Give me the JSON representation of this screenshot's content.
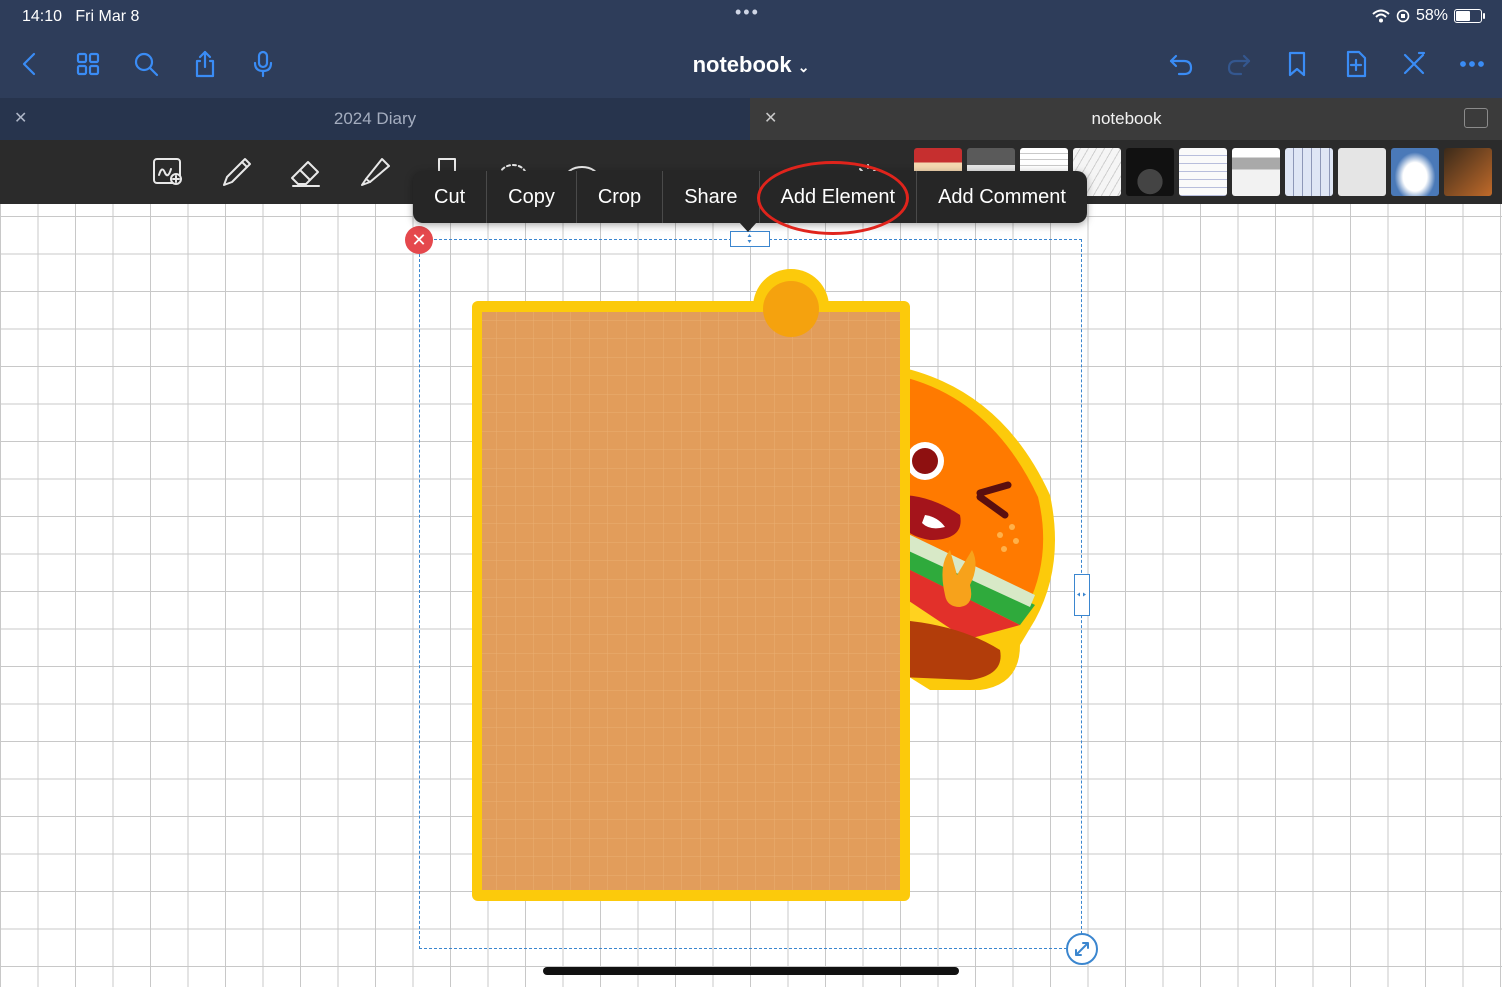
{
  "status": {
    "time": "14:10",
    "date": "Fri Mar 8",
    "battery": "58%",
    "battery_level": 0.58
  },
  "header": {
    "title": "notebook",
    "left_icons": [
      "back-icon",
      "grid-icon",
      "search-icon",
      "share-icon",
      "microphone-icon"
    ],
    "right_icons": [
      "undo-icon",
      "redo-icon",
      "bookmark-icon",
      "add-page-icon",
      "close-toolbar-icon",
      "more-icon"
    ]
  },
  "tabs": [
    {
      "label": "2024 Diary",
      "active": false
    },
    {
      "label": "notebook",
      "active": true
    }
  ],
  "tools": [
    "scan-icon",
    "pen-icon",
    "eraser-icon",
    "highlighter-icon",
    "shape-icon",
    "lasso-icon",
    "element-icon",
    "image-icon",
    "keyboard-icon",
    "textbox-icon",
    "laser-icon"
  ],
  "context_menu": {
    "items": [
      "Cut",
      "Copy",
      "Crop",
      "Share",
      "Add Element",
      "Add Comment"
    ],
    "highlighted": "Add Element"
  },
  "sticker": {
    "description_name": "burger-sticker-note"
  },
  "colors": {
    "nav_bg": "#2e3d5a",
    "accent": "#3a8cf5",
    "menu_bg": "#262626",
    "highlight": "#e0241c",
    "selection": "#3b86cf",
    "note_fill": "#e29d5b",
    "note_border": "#fcca0b"
  }
}
